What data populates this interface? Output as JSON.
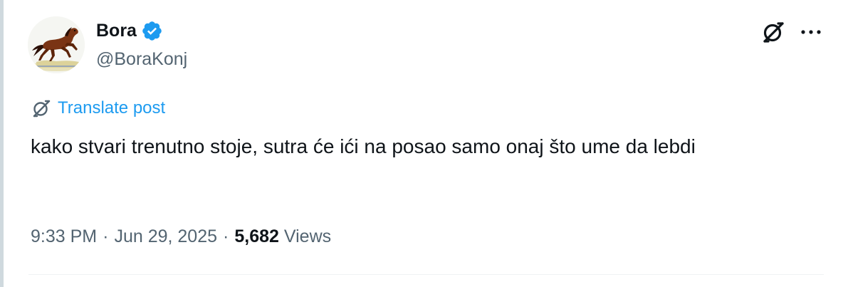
{
  "author": {
    "display_name": "Bora",
    "handle": "@BoraKonj",
    "verified_icon": "verified-badge-icon",
    "avatar_icon": "galloping-horse-avatar"
  },
  "actions": {
    "grok_icon": "grok-slash-icon",
    "more_icon": "more-dots-icon"
  },
  "translate": {
    "label": "Translate post",
    "icon": "grok-slash-icon"
  },
  "post": {
    "text": "kako stvari trenutno stoje, sutra će ići na posao samo onaj što ume da lebdi"
  },
  "meta": {
    "time": "9:33 PM",
    "separator": "·",
    "date": "Jun 29, 2025",
    "views_count": "5,682",
    "views_label": "Views"
  },
  "colors": {
    "text_primary": "#0f1419",
    "text_secondary": "#536471",
    "accent_blue": "#1d9bf0",
    "divider": "#eff3f4"
  }
}
